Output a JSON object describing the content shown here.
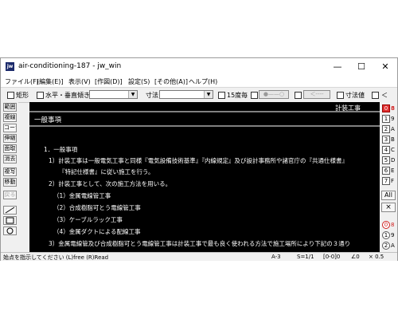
{
  "window": {
    "app_icon_text": "jw",
    "title": "air-conditioning-187 - jw_win",
    "controls": {
      "minimize": "—",
      "maximize": "☐",
      "close": "✕"
    }
  },
  "menu": [
    "ファイル(F)",
    "[編集(E)]",
    "表示(V)",
    "[作図(D)]",
    "設定(S)",
    "[その他(A)]",
    "ヘルプ(H)"
  ],
  "toolbar": {
    "rect_label": "矩形",
    "hv_label": "水平・垂直",
    "tilt_label": "傾き",
    "tilt_value": "",
    "dim_label": "寸法",
    "dim_value": "",
    "deg15_label": "15度毎",
    "arrow_btn": "●——○",
    "back_btn": "＜----",
    "dimval_label": "寸法値",
    "last_label": "＜"
  },
  "left_tools": [
    "範囲",
    "複線",
    "コーナー",
    "伸縮",
    "面取",
    "消去",
    "複写",
    "移動",
    "戻る"
  ],
  "right_tools": {
    "top": [
      {
        "c": "0",
        "n": "8"
      },
      {
        "c": "1",
        "n": "9"
      },
      {
        "c": "2",
        "n": "A"
      },
      {
        "c": "3",
        "n": "B"
      },
      {
        "c": "4",
        "n": "C"
      },
      {
        "c": "5",
        "n": "D"
      },
      {
        "c": "6",
        "n": "E"
      },
      {
        "c": "7",
        "n": "F"
      }
    ],
    "all": "All",
    "x": "×",
    "bottom": [
      {
        "c": "0",
        "n": "8"
      },
      {
        "c": "1",
        "n": "9"
      },
      {
        "c": "2",
        "n": "A"
      }
    ]
  },
  "drawing": {
    "corner_title": "計装工事",
    "section_title": "一般事項",
    "lines": [
      "1．一般事項",
      "1）計装工事は一般電気工事と同様『電気設備技術基準』『内線規定』及び設計事務所や諸官庁の『共通仕様書』",
      "『特記仕様書』に従い施工を行う。",
      "2）計装工事として、次の施工方法を用いる。",
      "（1）金属電線管工事",
      "（2）合成樹脂可とう電線管工事",
      "（3）ケーブルラック工事",
      "（4）金属ダクトによる配線工事",
      "3）金属電線管及び合成樹脂可とう電線管工事は計装工事で最も良く使われる方法で施工場所により下記の３通り"
    ]
  },
  "status": {
    "message": "始点を指示してください (L)free (R)Read",
    "paper": "A-3",
    "scale": "S=1/1",
    "layer": "[0-0]0",
    "angle": "∠0",
    "zoom": "× 0.5"
  }
}
